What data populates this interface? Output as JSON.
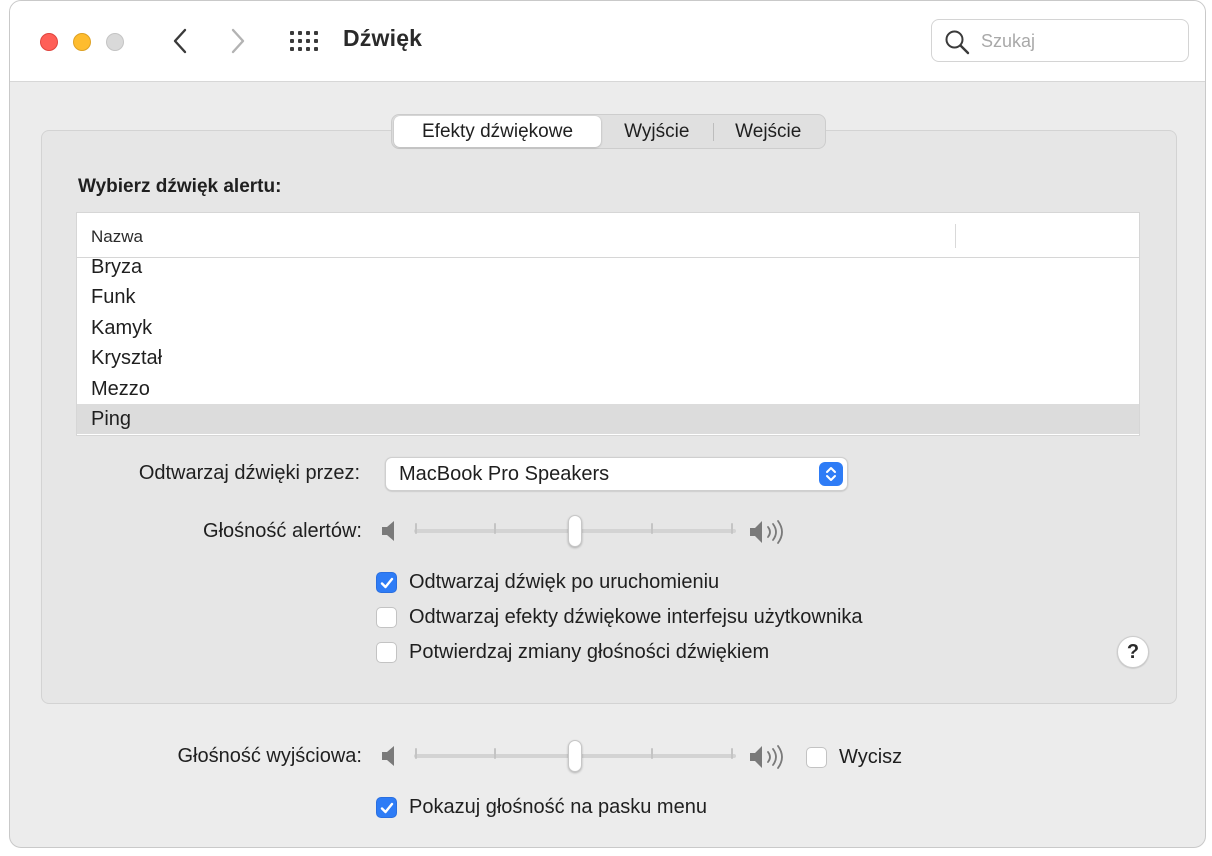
{
  "window": {
    "title": "Dźwięk"
  },
  "toolbar": {
    "back_icon": "chevron-left-icon",
    "forward_icon": "chevron-right-icon",
    "grid_icon": "grid-dots-icon",
    "search_placeholder": "Szukaj"
  },
  "tabs": [
    {
      "label": "Efekty dźwiękowe",
      "active": true
    },
    {
      "label": "Wyjście",
      "active": false
    },
    {
      "label": "Wejście",
      "active": false
    }
  ],
  "alert_section": {
    "title": "Wybierz dźwięk alertu:",
    "column_header": "Nazwa",
    "sounds": [
      "Bryza",
      "Funk",
      "Kamyk",
      "Kryształ",
      "Mezzo",
      "Ping"
    ],
    "selected": "Ping"
  },
  "play_through": {
    "label": "Odtwarzaj dźwięki przez:",
    "value": "MacBook Pro Speakers"
  },
  "alert_volume": {
    "label": "Głośność alertów:",
    "level": 0.5
  },
  "options": [
    {
      "label": "Odtwarzaj dźwięk po uruchomieniu",
      "checked": true
    },
    {
      "label": "Odtwarzaj efekty dźwiękowe interfejsu użytkownika",
      "checked": false
    },
    {
      "label": "Potwierdzaj zmiany głośności dźwiękiem",
      "checked": false
    }
  ],
  "help_label": "?",
  "output_volume": {
    "label": "Głośność wyjściowa:",
    "level": 0.5,
    "mute_label": "Wycisz",
    "mute_checked": false
  },
  "menu_bar_option": {
    "label": "Pokazuj głośność na pasku menu",
    "checked": true
  },
  "colors": {
    "accent": "#2e7cf6",
    "close": "#ff5f57",
    "minimize": "#febc2e",
    "zoom_disabled": "#d9d9d9"
  }
}
